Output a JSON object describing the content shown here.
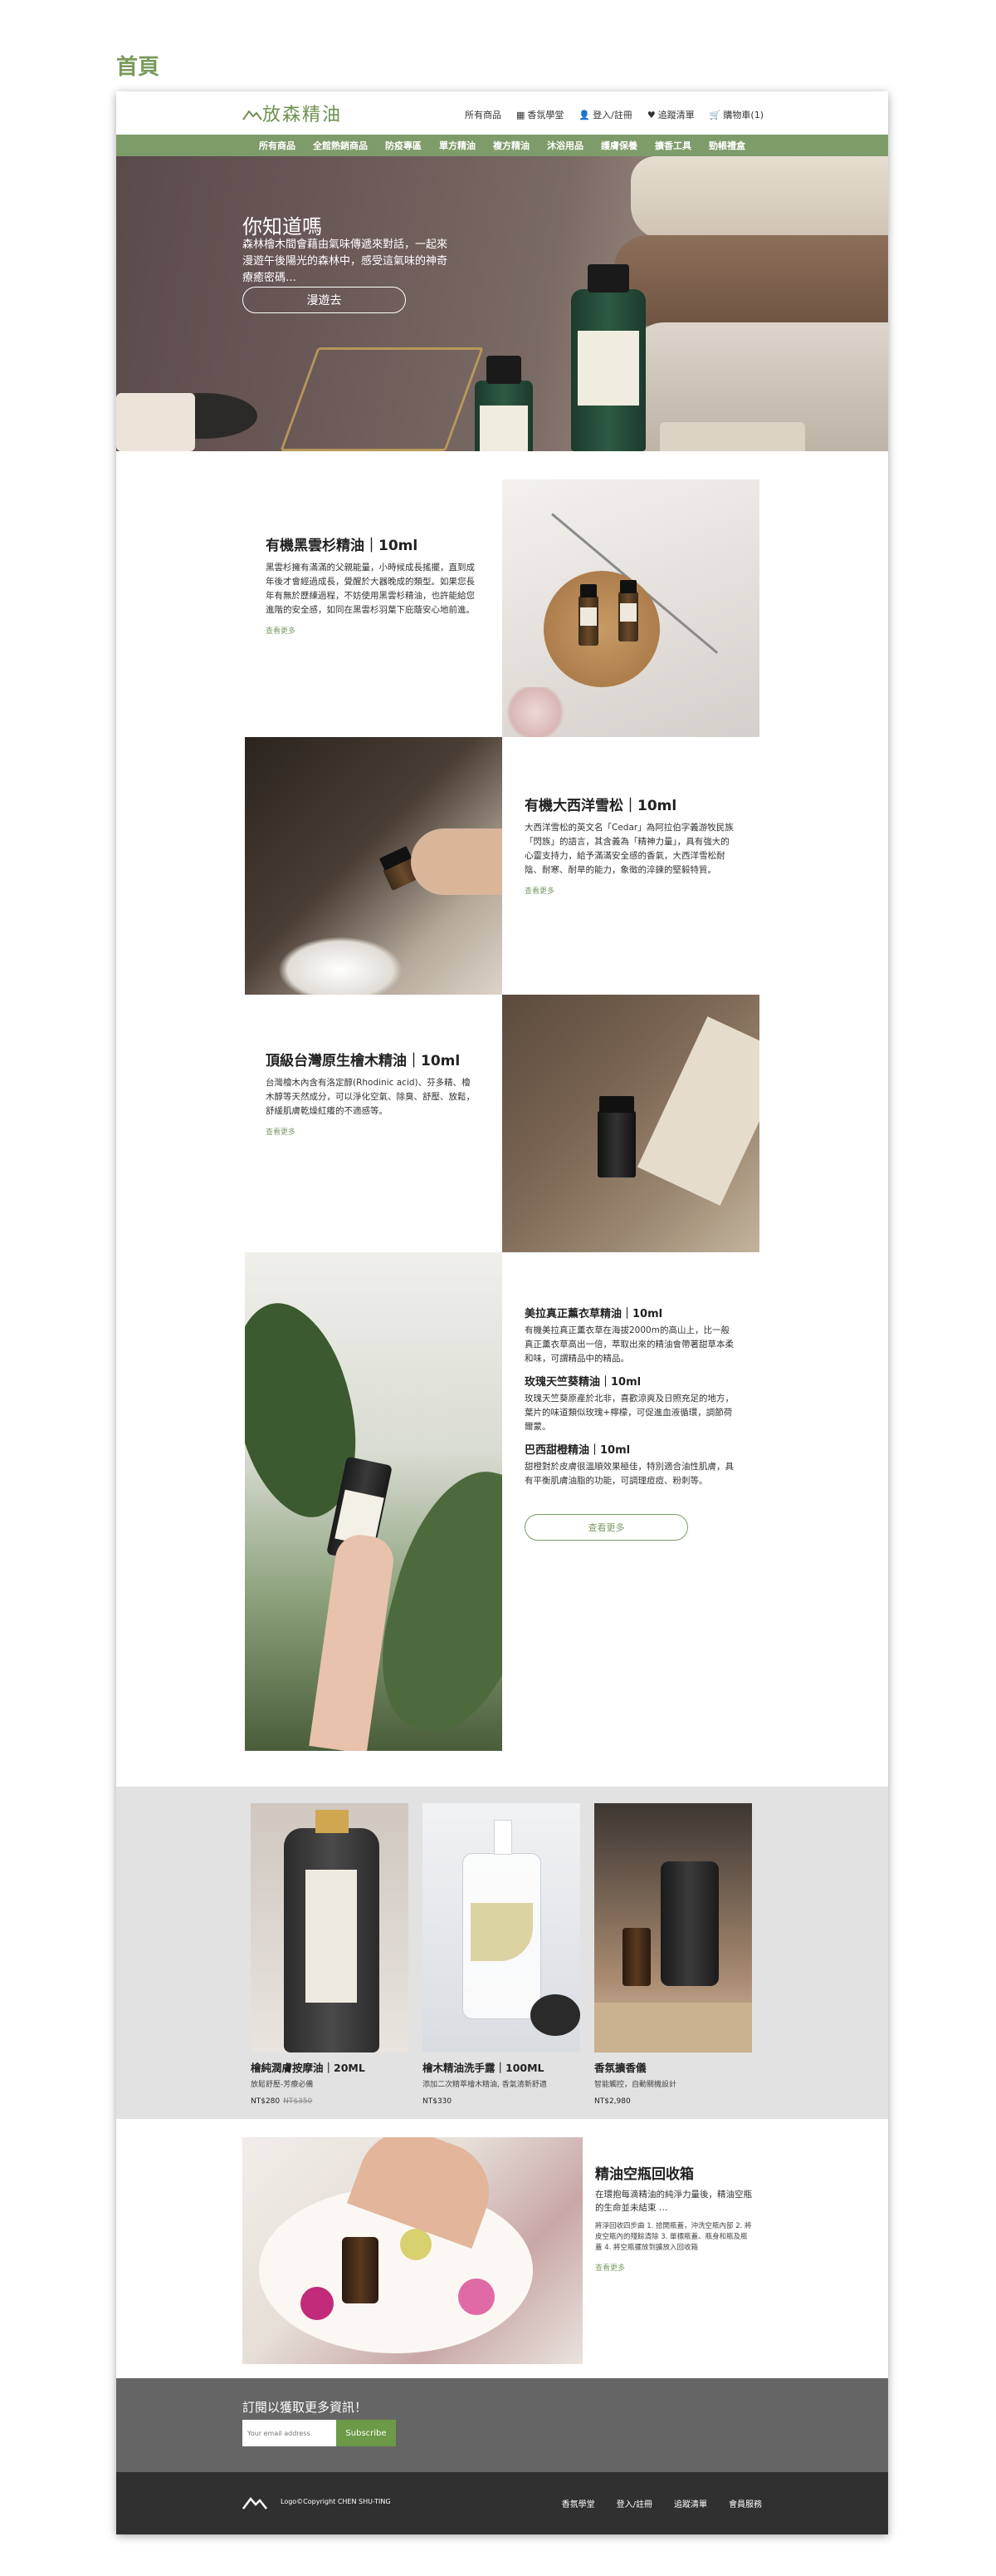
{
  "page": {
    "title": "首頁"
  },
  "header": {
    "logo": "放森精油",
    "links": {
      "all_products": "所有商品",
      "fragrance": "香氛學堂",
      "login": "登入/註冊",
      "wishlist": "追蹤清單",
      "cart": "購物車(1)"
    }
  },
  "nav": [
    "所有商品",
    "全館熱銷商品",
    "防疫專區",
    "單方精油",
    "複方精油",
    "沐浴用品",
    "護膚保養",
    "擴香工具",
    "勁帳禮盒"
  ],
  "hero": {
    "title": "你知道嗎",
    "text": "森林檜木間會藉由氣味傳遞來對話，一起來漫遊午後陽光的森林中，感受這氣味的神奇療癒密碼…",
    "button": "漫遊去"
  },
  "products": [
    {
      "title": "有機黑雲杉精油｜10ml",
      "text": "黑雲杉擁有滿滿的父親能量，小時候成長搖擺，直到成年後才會經過成長，覺醒於大器晚成的類型。如果您長年有無於歷練過程，不妨使用黑雲杉精油，也許能給您進階的安全感，如同在黑雲杉羽葉下庇蔭安心地前進。",
      "more": "查看更多"
    },
    {
      "title": "有機大西洋雪松｜10ml",
      "text": "大西洋雪松的英文名「Cedar」為阿拉伯字義游牧民族「閃族」的語言，其含義為「精神力量」，具有強大的心靈支持力，給予滿滿安全感的香氣，大西洋雪松耐陰、耐寒、耐旱的能力，象徵的淬鍊的堅毅特質。",
      "more": "查看更多"
    },
    {
      "title": "頂級台灣原生檜木精油｜10ml",
      "text": "台灣檜木內含有洛定醇(Rhodinic acid)、芬多精、檜木醇等天然成分，可以淨化空氣、除臭、舒壓、放鬆，舒緩肌膚乾燥紅癢的不適感等。",
      "more": "查看更多"
    }
  ],
  "multi": {
    "items": [
      {
        "title": "美拉真正薰衣草精油｜10ml",
        "text": "有機美拉真正薰衣草在海拔2000m的高山上，比一般真正薰衣草高出一倍，萃取出來的精油會帶著甜草本柔和味，可謂精品中的精品。"
      },
      {
        "title": "玫瑰天竺葵精油｜10ml",
        "text": "玫瑰天竺葵原產於北非，喜歡涼爽及日照充足的地方，葉片的味道類似玫瑰+檸檬，可促進血液循環，調節荷爾蒙。"
      },
      {
        "title": "巴西甜橙精油｜10ml",
        "text": "甜橙對於皮膚很溫順效果極佳，特別適合油性肌膚，具有平衡肌膚油脂的功能，可調理痘痘、粉刺等。"
      }
    ],
    "button": "查看更多"
  },
  "cards": [
    {
      "name": "檜純潤膚按摩油｜20ML",
      "desc": "放鬆舒壓-芳療必備",
      "price": "NT$280",
      "old_price": "NT$350"
    },
    {
      "name": "檜木精油洗手露｜100ML",
      "desc": "添加二次精萃檜木精油, 香氣清新舒適",
      "price": "NT$330",
      "old_price": ""
    },
    {
      "name": "香氛擴香儀",
      "desc": "智能觸控，自動關機設計",
      "price": "NT$2,980",
      "old_price": ""
    }
  ],
  "recycle": {
    "title": "精油空瓶回收箱",
    "sub": "在環抱每滴精油的純淨力量後，精油空瓶的生命並未結束 …",
    "small": "將淨回收四步曲 1. 拾開瓶蓋，沖洗空瓶內部 2. 將皮空瓶內的殘餘清除 3. 單標瓶蓋、瓶身和瓶及瓶蓋 4. 將空瓶擺放到擴放入回收箱",
    "more": "查看更多"
  },
  "subscribe": {
    "title": "訂閱以獲取更多資訊！",
    "placeholder": "Your email address",
    "button": "Subscribe"
  },
  "footer": {
    "copyright": "Logo©Copyright CHEN SHU-TING",
    "links": [
      "香氛學堂",
      "登入/註冊",
      "追蹤清單",
      "會員服務"
    ]
  },
  "colors": {
    "accent": "#7d9c6a",
    "title_green": "#7a9a5c",
    "subscribe_btn": "#6c9a48",
    "footer_bg": "#303030",
    "subscribe_bg": "#656565"
  }
}
